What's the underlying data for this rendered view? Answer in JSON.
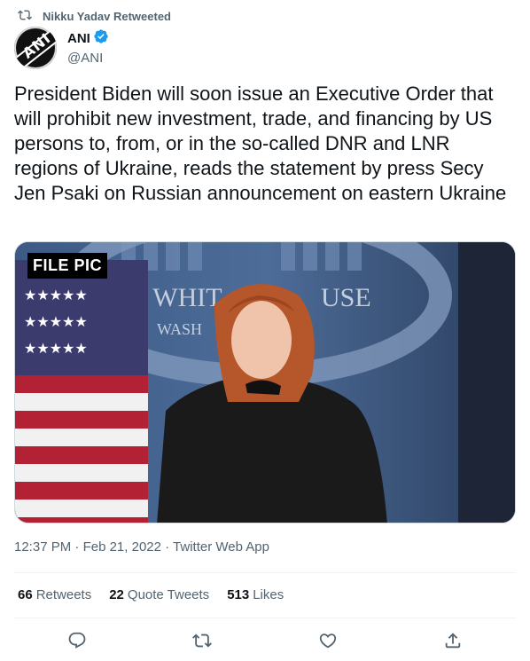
{
  "retweet": {
    "text": "Nikku Yadav Retweeted"
  },
  "author": {
    "display_name": "ANI",
    "handle": "@ANI",
    "avatar_text": "ANI",
    "verified": true
  },
  "tweet": {
    "text": "President Biden will soon issue an Executive Order that will prohibit new investment, trade, and financing by US persons to, from, or in the so-called DNR and LNR regions of Ukraine, reads the statement by press Secy Jen Psaki on Russian announcement on eastern Ukraine",
    "media_label": "FILE PIC",
    "media_backdrop_text_1": "E WHIT",
    "media_backdrop_text_2": "USE",
    "media_backdrop_text_3": "WASH"
  },
  "meta": {
    "time": "12:37 PM",
    "date": "Feb 21, 2022",
    "source": "Twitter Web App"
  },
  "stats": {
    "retweets_count": "66",
    "retweets_label": "Retweets",
    "quotes_count": "22",
    "quotes_label": "Quote Tweets",
    "likes_count": "513",
    "likes_label": "Likes"
  },
  "colors": {
    "text_primary": "#0f1419",
    "text_secondary": "#536471",
    "verified_blue": "#1d9bf0",
    "divider": "#eff3f4"
  }
}
